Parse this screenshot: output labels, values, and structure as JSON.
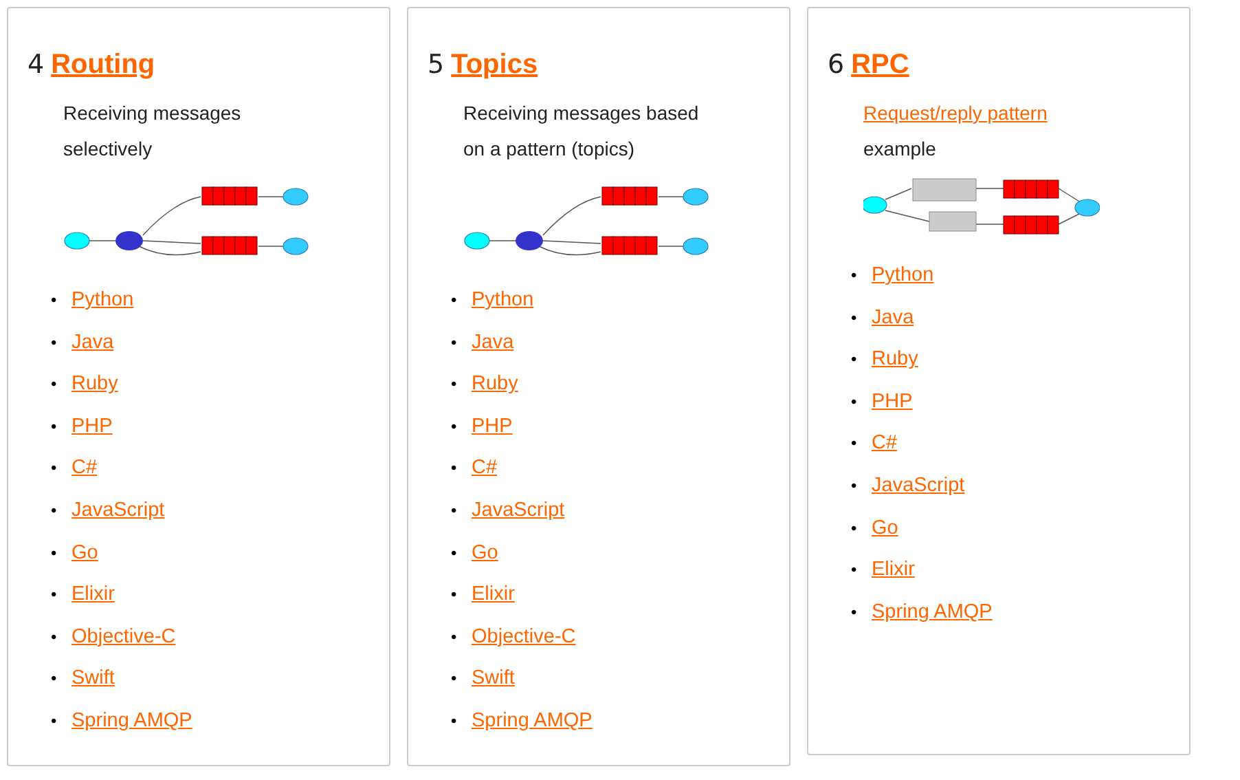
{
  "cards": [
    {
      "number": "4",
      "title": "Routing",
      "bullet": "•",
      "description": [
        {
          "text": "Receiving messages selectively",
          "link": false
        }
      ],
      "diagram": {
        "kind": "routing"
      },
      "links": [
        "Python",
        "Java",
        "Ruby",
        "PHP",
        "C#",
        "JavaScript",
        "Go",
        "Elixir",
        "Objective-C",
        "Swift",
        "Spring AMQP"
      ]
    },
    {
      "number": "5",
      "title": "Topics",
      "bullet": "•",
      "description": [
        {
          "text": "Receiving messages based on a pattern (topics)",
          "link": false
        }
      ],
      "diagram": {
        "kind": "topics"
      },
      "links": [
        "Python",
        "Java",
        "Ruby",
        "PHP",
        "C#",
        "JavaScript",
        "Go",
        "Elixir",
        "Objective-C",
        "Swift",
        "Spring AMQP"
      ]
    },
    {
      "number": "6",
      "title": "RPC",
      "bullet": "•",
      "description": [
        {
          "text": "Request/reply pattern",
          "link": true
        },
        {
          "text": "example",
          "link": false
        }
      ],
      "diagram": {
        "kind": "rpc"
      },
      "links": [
        "Python",
        "Java",
        "Ruby",
        "PHP",
        "C#",
        "JavaScript",
        "Go",
        "Elixir",
        "Spring AMQP"
      ]
    }
  ]
}
